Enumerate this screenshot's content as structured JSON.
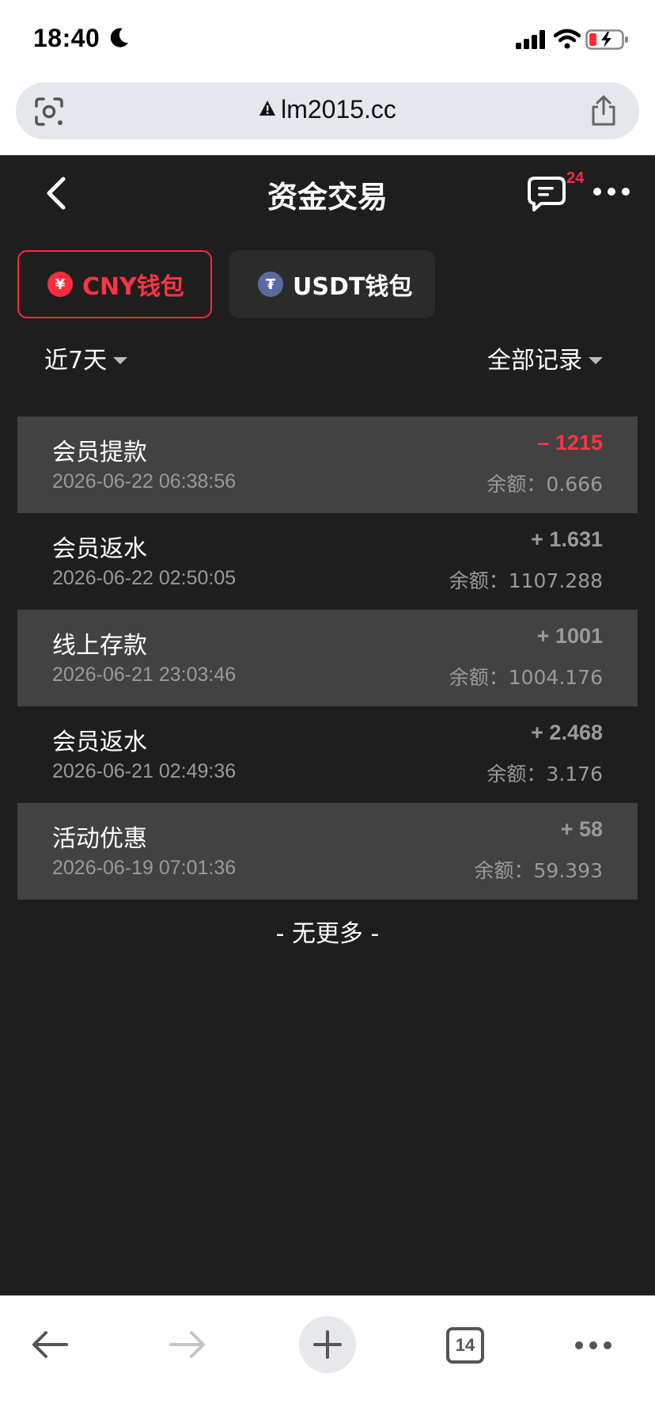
{
  "status_bar": {
    "time": "18:40"
  },
  "browser": {
    "url": "lm2015.cc",
    "tab_count": "14"
  },
  "header": {
    "title": "资金交易",
    "message_badge": "24"
  },
  "wallet_tabs": [
    {
      "label": "CNY钱包",
      "coin_symbol": "¥",
      "active": true
    },
    {
      "label": "USDT钱包",
      "coin_symbol": "₮",
      "active": false
    }
  ],
  "filters": {
    "period": "近7天",
    "record_type": "全部记录"
  },
  "transactions": [
    {
      "type": "会员提款",
      "datetime": "2026-06-22 06:38:56",
      "amount": "– 1215",
      "balance": "余额：0.666"
    },
    {
      "type": "会员返水",
      "datetime": "2026-06-22 02:50:05",
      "amount": "+ 1.631",
      "balance": "余额：1107.288"
    },
    {
      "type": "线上存款",
      "datetime": "2026-06-21 23:03:46",
      "amount": "+ 1001",
      "balance": "余额：1004.176"
    },
    {
      "type": "会员返水",
      "datetime": "2026-06-21 02:49:36",
      "amount": "+ 2.468",
      "balance": "余额：3.176"
    },
    {
      "type": "活动优惠",
      "datetime": "2026-06-19 07:01:36",
      "amount": "+ 58",
      "balance": "余额：59.393"
    }
  ],
  "no_more_text": "- 无更多 -",
  "icons": {
    "moon": "moon-icon",
    "signal": "cellular-signal-icon",
    "wifi": "wifi-icon",
    "battery": "battery-charging-icon",
    "lens": "camera-lens-icon",
    "warning": "warning-icon",
    "share": "share-icon",
    "back": "chevron-left-icon",
    "message": "message-icon",
    "more": "more-dots-icon",
    "nav_back": "arrow-left-icon",
    "nav_forward": "arrow-right-icon",
    "new_tab": "plus-icon",
    "menu": "more-dots-icon"
  },
  "colors": {
    "accent_red": "#ff2a3a",
    "app_bg": "#1e1e1e",
    "row_alt": "#424242",
    "muted_text": "#9a9a9a"
  }
}
